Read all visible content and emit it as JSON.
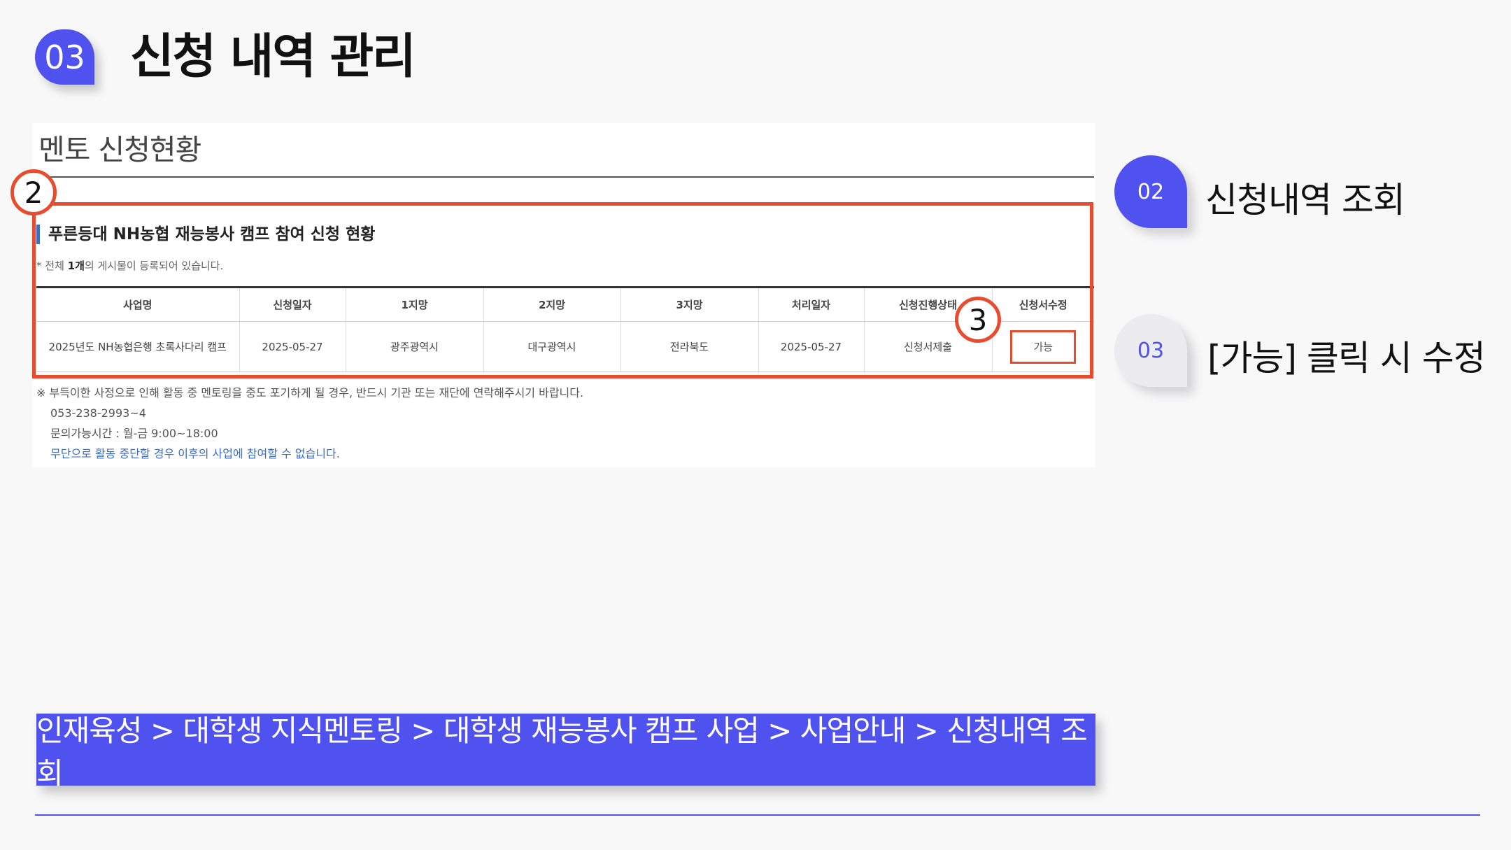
{
  "header": {
    "number": "03",
    "title": "신청 내역 관리"
  },
  "screenshot": {
    "title": "멘토 신청현황",
    "sub_heading": "푸른등대 NH농협 재능봉사 캠프 참여 신청 현황",
    "count_prefix": "* 전체 ",
    "count_value": "1개",
    "count_suffix": "의 게시물이 등록되어 있습니다.",
    "table": {
      "headers": [
        "사업명",
        "신청일자",
        "1지망",
        "2지망",
        "3지망",
        "처리일자",
        "신청진행상태",
        "신청서수정"
      ],
      "row": {
        "business_name": "2025년도 NH농협은행 초록사다리 캠프",
        "apply_date": "2025-05-27",
        "choice1": "광주광역시",
        "choice2": "대구광역시",
        "choice3": "전라북도",
        "process_date": "2025-05-27",
        "status": "신청서제출",
        "edit": "가능"
      }
    },
    "notice": {
      "line1": "※ 부득이한 사정으로 인해 활동 중 멘토링을 중도 포기하게 될 경우, 반드시 기관 또는 재단에 연락해주시기 바랍니다.",
      "phone": "053-238-2993~4",
      "hours": "문의가능시간 : 월-금 9:00~18:00",
      "warning": "무단으로 활동 중단할 경우 이후의 사업에 참여할 수 없습니다."
    },
    "markers": [
      "2",
      "3"
    ]
  },
  "steps": [
    {
      "number": "02",
      "label": "신청내역 조회",
      "state": "active"
    },
    {
      "number": "03",
      "label": "[가능] 클릭 시 수정",
      "state": "inactive"
    }
  ],
  "breadcrumb": "인재육성 > 대학생 지식멘토링 > 대학생 재능봉사 캠프 사업 > 사업안내 > 신청내역 조회",
  "colors": {
    "accent": "#4f52ef",
    "highlight": "#e74c2e"
  }
}
